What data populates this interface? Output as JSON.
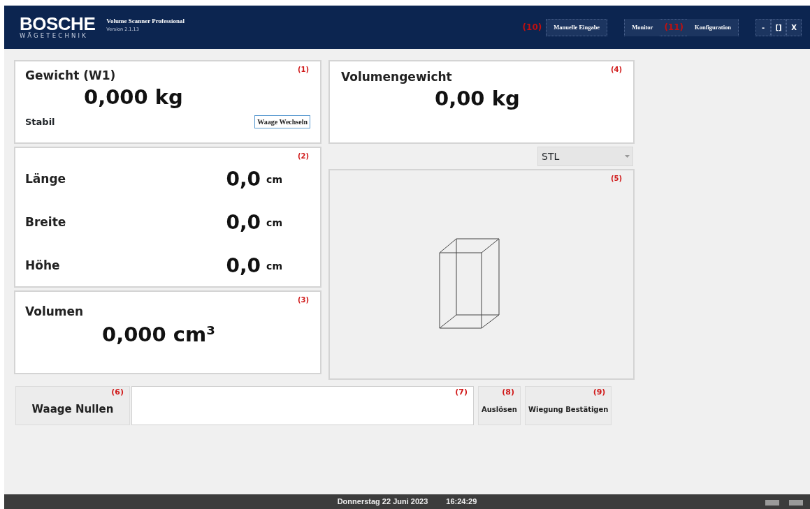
{
  "header": {
    "logo": {
      "brand": "BOSCHE",
      "sub": "WÄGETECHNIK"
    },
    "title": "Volume Scanner Professional",
    "version": "Version 2.1.13",
    "buttons": [
      {
        "kind": "marker",
        "text": "(10)"
      },
      {
        "kind": "button",
        "text": "Manuelle Eingabe"
      },
      {
        "kind": "group",
        "items": [
          {
            "kind": "button",
            "text": "Monitor"
          },
          {
            "kind": "marker",
            "text": "(11)"
          },
          {
            "kind": "button",
            "text": "Konfiguration"
          }
        ]
      }
    ],
    "window_controls": [
      "-",
      "[]",
      "X"
    ]
  },
  "weight": {
    "label": "Gewicht (W1)",
    "marker": "(1)",
    "value": "0,000 kg",
    "status": "Stabil",
    "button": "Waage Wechseln"
  },
  "dimensions": {
    "marker": "(2)",
    "rows": [
      {
        "label": "Länge",
        "value": "0,0",
        "unit": "cm"
      },
      {
        "label": "Breite",
        "value": "0,0",
        "unit": "cm"
      },
      {
        "label": "Höhe",
        "value": "0,0",
        "unit": "cm"
      }
    ]
  },
  "volume": {
    "label": "Volumen",
    "marker": "(3)",
    "value": "0,000 cm³"
  },
  "volumetric_weight": {
    "label": "Volumengewicht",
    "marker": "(4)",
    "value": "0,00 kg"
  },
  "format_select": {
    "value": "STL"
  },
  "preview": {
    "marker": "(5)"
  },
  "actions": [
    {
      "kind": "large_button",
      "text": "Waage Nullen",
      "marker": "(6)"
    },
    {
      "kind": "field",
      "marker": "(7)"
    },
    {
      "kind": "button",
      "text": "Auslösen",
      "marker": "(8)"
    },
    {
      "kind": "button",
      "text": "Wiegung Bestätigen",
      "marker": "(9)"
    }
  ],
  "status_bar": {
    "date": "Donnerstag 22 Juni 2023",
    "time": "16:24:29"
  }
}
